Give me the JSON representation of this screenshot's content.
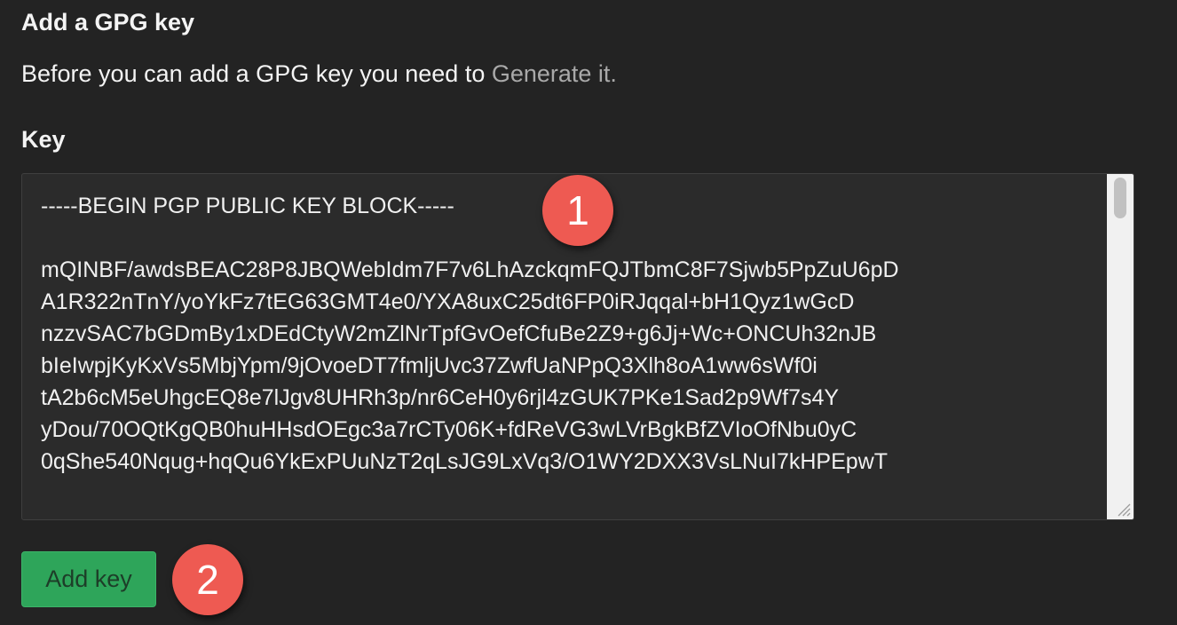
{
  "section": {
    "title": "Add a GPG key",
    "intro_text": "Before you can add a GPG key you need to ",
    "generate_link": "Generate it."
  },
  "key_field": {
    "label": "Key",
    "value": "-----BEGIN PGP PUBLIC KEY BLOCK-----\n\nmQINBF/awdsBEAC28P8JBQWebIdm7F7v6LhAzckqmFQJTbmC8F7Sjwb5PpZuU6pD\nA1R322nTnY/yoYkFz7tEG63GMT4e0/YXA8uxC25dt6FP0iRJqqal+bH1Qyz1wGcD\nnzzvSAC7bGDmBy1xDEdCtyW2mZlNrTpfGvOefCfuBe2Z9+g6Jj+Wc+ONCUh32nJB\nbIeIwpjKyKxVs5MbjYpm/9jOvoeDT7fmljUvc37ZwfUaNPpQ3Xlh8oA1ww6sWf0i\ntA2b6cM5eUhgcEQ8e7lJgv8UHRh3p/nr6CeH0y6rjl4zGUK7PKe1Sad2p9Wf7s4Y\nyDou/70OQtKgQB0huHHsdOEgc3a7rCTy06K+fdReVG3wLVrBgkBfZVIoOfNbu0yC\n0qShe540Nqug+hqQu6YkExPUuNzT2qLsJG9LxVq3/O1WY2DXX3VsLNuI7kHPEpwT"
  },
  "annotations": {
    "badge_1": "1",
    "badge_2": "2"
  },
  "actions": {
    "add_key_label": "Add key"
  },
  "colors": {
    "background": "#232323",
    "button_green": "#2ea55a",
    "badge_red": "#ee5a52",
    "link_gray": "#a9a9a9"
  }
}
